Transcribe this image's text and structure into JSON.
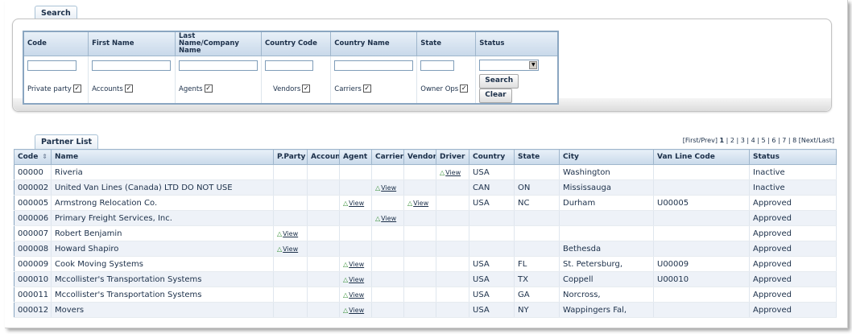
{
  "search": {
    "tab_label": "Search",
    "headers": [
      "Code",
      "First Name",
      "Last Name/Company Name",
      "Country Code",
      "Country Name",
      "State",
      "Status"
    ],
    "fields": {
      "code": "",
      "first_name": "",
      "last_name": "",
      "country_code": "",
      "country_name": "",
      "state": "",
      "status": ""
    },
    "checkboxes": [
      {
        "label": "Private party",
        "checked": true
      },
      {
        "label": "Accounts",
        "checked": true
      },
      {
        "label": "Agents",
        "checked": true
      },
      {
        "label": "Vendors",
        "checked": true
      },
      {
        "label": "Carriers",
        "checked": true
      },
      {
        "label": "Owner Ops",
        "checked": true
      }
    ],
    "search_button": "Search",
    "clear_button": "Clear"
  },
  "partner_list": {
    "tab_label": "Partner List",
    "pager": {
      "first_prev": "[First/Prev]",
      "pages": [
        "1",
        "2",
        "3",
        "4",
        "5",
        "6",
        "7",
        "8"
      ],
      "current": "1",
      "next_last": "[Next/Last]"
    },
    "view_label": "View",
    "columns": [
      "Code",
      "Name",
      "P.Party",
      "Account",
      "Agent",
      "Carrier",
      "Vendor",
      "Driver",
      "Country",
      "State",
      "City",
      "Van Line Code",
      "Status"
    ],
    "rows": [
      {
        "code": "00000",
        "name": "Riveria",
        "views": [
          "driver"
        ],
        "country": "USA",
        "state": "",
        "city": "Washington",
        "van_line_code": "",
        "status": "Inactive"
      },
      {
        "code": "000002",
        "name": "United Van Lines (Canada) LTD DO NOT USE",
        "views": [
          "carrier"
        ],
        "country": "CAN",
        "state": "ON",
        "city": "Mississauga",
        "van_line_code": "",
        "status": "Inactive"
      },
      {
        "code": "000005",
        "name": "Armstrong Relocation Co.",
        "views": [
          "agent",
          "vendor"
        ],
        "country": "USA",
        "state": "NC",
        "city": "Durham",
        "van_line_code": "U00005",
        "status": "Approved"
      },
      {
        "code": "000006",
        "name": "Primary Freight Services, Inc.",
        "views": [
          "carrier"
        ],
        "country": "",
        "state": "",
        "city": "",
        "van_line_code": "",
        "status": "Approved"
      },
      {
        "code": "000007",
        "name": "Robert Benjamin",
        "views": [
          "pparty"
        ],
        "country": "",
        "state": "",
        "city": "",
        "van_line_code": "",
        "status": "Approved"
      },
      {
        "code": "000008",
        "name": "Howard Shapiro",
        "views": [
          "pparty"
        ],
        "country": "",
        "state": "",
        "city": "Bethesda",
        "van_line_code": "",
        "status": "Approved"
      },
      {
        "code": "000009",
        "name": "Cook Moving Systems",
        "views": [
          "agent"
        ],
        "country": "USA",
        "state": "FL",
        "city": "St. Petersburg,",
        "van_line_code": "U00009",
        "status": "Approved"
      },
      {
        "code": "000010",
        "name": "Mccollister's Transportation Systems",
        "views": [
          "agent"
        ],
        "country": "USA",
        "state": "TX",
        "city": "Coppell",
        "van_line_code": "U00010",
        "status": "Approved"
      },
      {
        "code": "000011",
        "name": "Mccollister's Transportation Systems",
        "views": [
          "agent"
        ],
        "country": "USA",
        "state": "GA",
        "city": "Norcross,",
        "van_line_code": "",
        "status": "Approved"
      },
      {
        "code": "000012",
        "name": "Movers",
        "views": [
          "agent"
        ],
        "country": "USA",
        "state": "NY",
        "city": "Wappingers Fal,",
        "van_line_code": "",
        "status": "Approved"
      }
    ]
  }
}
